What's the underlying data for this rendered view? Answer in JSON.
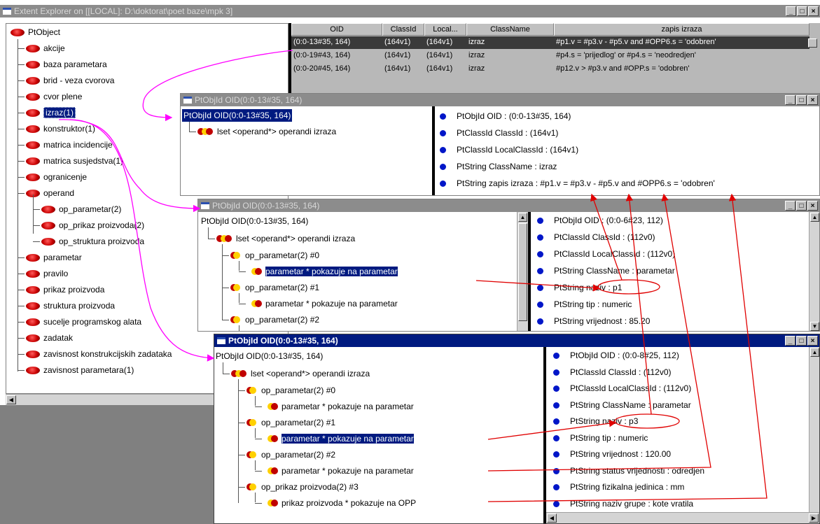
{
  "explorer": {
    "title": "Extent Explorer on [[LOCAL]: D:\\doktorat\\poet baze\\mpk 3]",
    "tree": [
      "PtObject",
      "akcije",
      "baza parametara",
      "brid - veza cvorova",
      "cvor plene",
      "izraz(1)",
      "konstruktor(1)",
      "matrica incidencije",
      "matrica susjedstva(1)",
      "ogranicenje",
      "operand",
      "op_parametar(2)",
      "op_prikaz proizvoda(2)",
      "op_struktura proizvoda",
      "parametar",
      "pravilo",
      "prikaz proizvoda",
      "struktura proizvoda",
      "sucelje programskog alata",
      "zadatak",
      "zavisnost konstrukcijskih zadataka",
      "zavisnost parametara(1)"
    ],
    "grid": {
      "headers": [
        "OID",
        "ClassId",
        "Local...",
        "ClassName",
        "zapis izraza"
      ],
      "rows": [
        [
          "(0:0-13#35, 164)",
          "(164v1)",
          "(164v1)",
          "izraz",
          "#p1.v = #p3.v - #p5.v  and #OPP6.s = 'odobren'"
        ],
        [
          "(0:0-19#43, 164)",
          "(164v1)",
          "(164v1)",
          "izraz",
          "#p4.s = 'prijedlog' or #p4.s = 'neodredjen'"
        ],
        [
          "(0:0-20#45, 164)",
          "(164v1)",
          "(164v1)",
          "izraz",
          "#p12.v > #p3.v  and  #OPP.s = 'odobren'"
        ]
      ]
    }
  },
  "win1": {
    "title": "PtObjId OID(0:0-13#35, 164)",
    "tree_root": "PtObjId OID(0:0-13#35, 164)",
    "lset": "lset  <operand*>     operandi izraza",
    "props": [
      "PtObjId OID : (0:0-13#35, 164)",
      "PtClassId ClassId : (164v1)",
      "PtClassId LocalClassId : (164v1)",
      "PtString ClassName : izraz",
      "PtString   zapis izraza : #p1.v  = #p3.v - #p5.v  and #OPP6.s = 'odobren'"
    ]
  },
  "win2": {
    "title": "PtObjId OID(0:0-13#35, 164)",
    "tree_root": "PtObjId OID(0:0-13#35, 164)",
    "lset": "lset  <operand*>     operandi izraza",
    "items": [
      "op_parametar(2) #0",
      "parametar  * pokazuje na parametar",
      "op_parametar(2) #1",
      "parametar  * pokazuje na parametar",
      "op_parametar(2) #2"
    ],
    "props": [
      "PtObjId OID : (0:0-6#23, 112)",
      "PtClassId ClassId : (112v0)",
      "PtClassId LocalClassId : (112v0)",
      "PtString ClassName : parametar",
      "PtString  naziv : p1",
      "PtString   tip : numeric",
      "PtString   vrijednost : 85.20"
    ]
  },
  "win3": {
    "title": "PtObjId OID(0:0-13#35, 164)",
    "tree_root": "PtObjId OID(0:0-13#35, 164)",
    "lset": "lset  <operand*>     operandi izraza",
    "items": [
      "op_parametar(2) #0",
      "parametar  * pokazuje na parametar",
      "op_parametar(2) #1",
      "parametar  * pokazuje na parametar",
      "op_parametar(2) #2",
      "parametar  * pokazuje na parametar",
      "op_prikaz proizvoda(2) #3",
      "prikaz proizvoda  * pokazuje na OPP"
    ],
    "props": [
      "PtObjId OID : (0:0-8#25, 112)",
      "PtClassId ClassId : (112v0)",
      "PtClassId LocalClassId : (112v0)",
      "PtString ClassName : parametar",
      "PtString  naziv : p3",
      "PtString   tip : numeric",
      "PtString   vrijednost : 120.00",
      "PtString   status vrijednosti : odredjen",
      "PtString   fizikalna jedinica : mm",
      "PtString   naziv grupe : kote vratila"
    ]
  },
  "controls": {
    "minimize": "_",
    "maximize": "□",
    "close": "×"
  },
  "colors": {
    "title_active": "#001a80",
    "title_inactive": "#8c8c8c",
    "selection": "#001a80",
    "annotation_red": "#e00000",
    "annotation_magenta": "#ff00ff"
  }
}
